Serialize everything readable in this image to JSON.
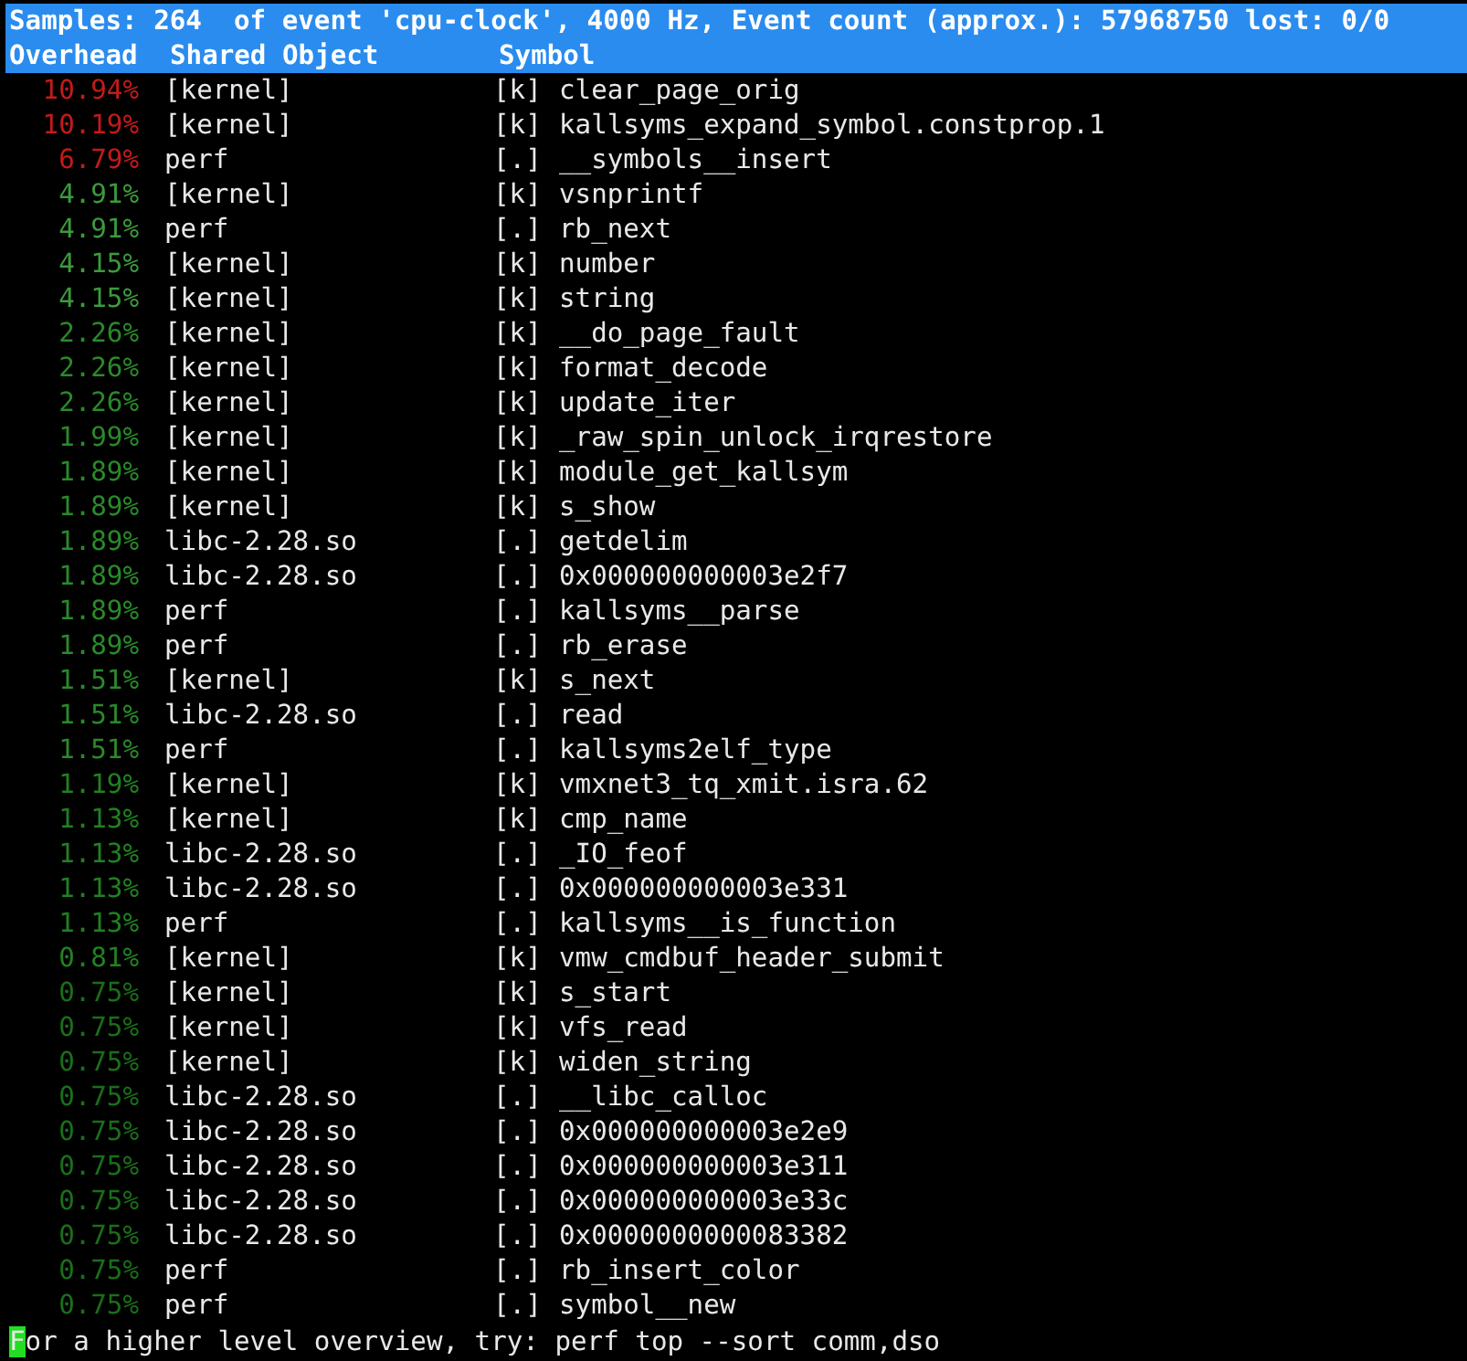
{
  "summary": "Samples: 264  of event 'cpu-clock', 4000 Hz, Event count (approx.): 57968750 lost: 0/0",
  "columns": [
    "Overhead",
    "Shared Object",
    "Symbol"
  ],
  "rows": [
    {
      "overhead": "10.94%",
      "color": "#c41a1a",
      "object": "[kernel]",
      "mark": "[k]",
      "symbol": "clear_page_orig"
    },
    {
      "overhead": "10.19%",
      "color": "#c41a1a",
      "object": "[kernel]",
      "mark": "[k]",
      "symbol": "kallsyms_expand_symbol.constprop.1"
    },
    {
      "overhead": "6.79%",
      "color": "#c41a1a",
      "object": "perf",
      "mark": "[.]",
      "symbol": "__symbols__insert"
    },
    {
      "overhead": "4.91%",
      "color": "#3c9a3c",
      "object": "[kernel]",
      "mark": "[k]",
      "symbol": "vsnprintf"
    },
    {
      "overhead": "4.91%",
      "color": "#3c9a3c",
      "object": "perf",
      "mark": "[.]",
      "symbol": "rb_next"
    },
    {
      "overhead": "4.15%",
      "color": "#3c9a3c",
      "object": "[kernel]",
      "mark": "[k]",
      "symbol": "number"
    },
    {
      "overhead": "4.15%",
      "color": "#3c9a3c",
      "object": "[kernel]",
      "mark": "[k]",
      "symbol": "string"
    },
    {
      "overhead": "2.26%",
      "color": "#2a8a2a",
      "object": "[kernel]",
      "mark": "[k]",
      "symbol": "__do_page_fault"
    },
    {
      "overhead": "2.26%",
      "color": "#2a8a2a",
      "object": "[kernel]",
      "mark": "[k]",
      "symbol": "format_decode"
    },
    {
      "overhead": "2.26%",
      "color": "#2a8a2a",
      "object": "[kernel]",
      "mark": "[k]",
      "symbol": "update_iter"
    },
    {
      "overhead": "1.99%",
      "color": "#2a8a2a",
      "object": "[kernel]",
      "mark": "[k]",
      "symbol": "_raw_spin_unlock_irqrestore"
    },
    {
      "overhead": "1.89%",
      "color": "#2a8a2a",
      "object": "[kernel]",
      "mark": "[k]",
      "symbol": "module_get_kallsym"
    },
    {
      "overhead": "1.89%",
      "color": "#2a8a2a",
      "object": "[kernel]",
      "mark": "[k]",
      "symbol": "s_show"
    },
    {
      "overhead": "1.89%",
      "color": "#2a8a2a",
      "object": "libc-2.28.so",
      "mark": "[.]",
      "symbol": "getdelim"
    },
    {
      "overhead": "1.89%",
      "color": "#2a8a2a",
      "object": "libc-2.28.so",
      "mark": "[.]",
      "symbol": "0x000000000003e2f7"
    },
    {
      "overhead": "1.89%",
      "color": "#2a8a2a",
      "object": "perf",
      "mark": "[.]",
      "symbol": "kallsyms__parse"
    },
    {
      "overhead": "1.89%",
      "color": "#2a8a2a",
      "object": "perf",
      "mark": "[.]",
      "symbol": "rb_erase"
    },
    {
      "overhead": "1.51%",
      "color": "#2a8a2a",
      "object": "[kernel]",
      "mark": "[k]",
      "symbol": "s_next"
    },
    {
      "overhead": "1.51%",
      "color": "#2a8a2a",
      "object": "libc-2.28.so",
      "mark": "[.]",
      "symbol": "read"
    },
    {
      "overhead": "1.51%",
      "color": "#2a8a2a",
      "object": "perf",
      "mark": "[.]",
      "symbol": "kallsyms2elf_type"
    },
    {
      "overhead": "1.19%",
      "color": "#228022",
      "object": "[kernel]",
      "mark": "[k]",
      "symbol": "vmxnet3_tq_xmit.isra.62"
    },
    {
      "overhead": "1.13%",
      "color": "#228022",
      "object": "[kernel]",
      "mark": "[k]",
      "symbol": "cmp_name"
    },
    {
      "overhead": "1.13%",
      "color": "#228022",
      "object": "libc-2.28.so",
      "mark": "[.]",
      "symbol": "_IO_feof"
    },
    {
      "overhead": "1.13%",
      "color": "#228022",
      "object": "libc-2.28.so",
      "mark": "[.]",
      "symbol": "0x000000000003e331"
    },
    {
      "overhead": "1.13%",
      "color": "#228022",
      "object": "perf",
      "mark": "[.]",
      "symbol": "kallsyms__is_function"
    },
    {
      "overhead": "0.81%",
      "color": "#228022",
      "object": "[kernel]",
      "mark": "[k]",
      "symbol": "vmw_cmdbuf_header_submit"
    },
    {
      "overhead": "0.75%",
      "color": "#1a6e1a",
      "object": "[kernel]",
      "mark": "[k]",
      "symbol": "s_start"
    },
    {
      "overhead": "0.75%",
      "color": "#1a6e1a",
      "object": "[kernel]",
      "mark": "[k]",
      "symbol": "vfs_read"
    },
    {
      "overhead": "0.75%",
      "color": "#1a6e1a",
      "object": "[kernel]",
      "mark": "[k]",
      "symbol": "widen_string"
    },
    {
      "overhead": "0.75%",
      "color": "#1a6e1a",
      "object": "libc-2.28.so",
      "mark": "[.]",
      "symbol": "__libc_calloc"
    },
    {
      "overhead": "0.75%",
      "color": "#1a6e1a",
      "object": "libc-2.28.so",
      "mark": "[.]",
      "symbol": "0x000000000003e2e9"
    },
    {
      "overhead": "0.75%",
      "color": "#1a6e1a",
      "object": "libc-2.28.so",
      "mark": "[.]",
      "symbol": "0x000000000003e311"
    },
    {
      "overhead": "0.75%",
      "color": "#1a6e1a",
      "object": "libc-2.28.so",
      "mark": "[.]",
      "symbol": "0x000000000003e33c"
    },
    {
      "overhead": "0.75%",
      "color": "#1a6e1a",
      "object": "libc-2.28.so",
      "mark": "[.]",
      "symbol": "0x0000000000083382"
    },
    {
      "overhead": "0.75%",
      "color": "#1a6e1a",
      "object": "perf",
      "mark": "[.]",
      "symbol": "rb_insert_color"
    },
    {
      "overhead": "0.75%",
      "color": "#1a6e1a",
      "object": "perf",
      "mark": "[.]",
      "symbol": "symbol__new"
    }
  ],
  "footer": {
    "text": "For a higher level overview, try: perf top --sort comm,dso",
    "cursor_visible": true
  }
}
